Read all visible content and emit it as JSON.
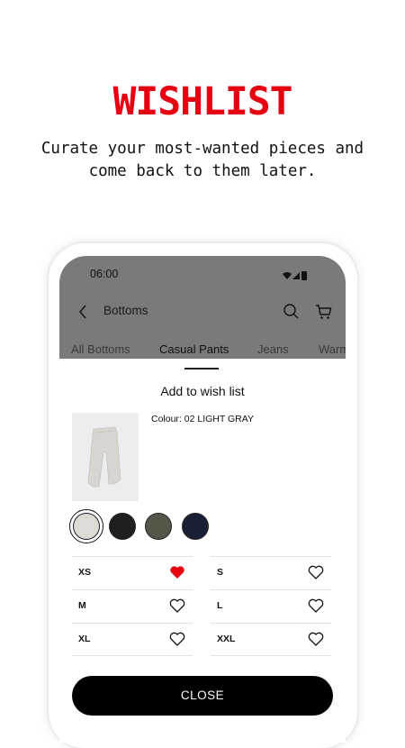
{
  "promo": {
    "title": "WISHLIST",
    "subtitle_line1": "Curate your most-wanted pieces and",
    "subtitle_line2": "come back to them later.",
    "title_color": "#e60012"
  },
  "phone": {
    "status_time": "06:00",
    "status_icons": [
      "wifi-icon",
      "signal-icon",
      "battery-icon"
    ],
    "appbar": {
      "title": "Bottoms",
      "icons": [
        "back-chevron-icon",
        "search-icon",
        "cart-icon"
      ]
    },
    "tabs": [
      {
        "label": "All Bottoms",
        "active": false
      },
      {
        "label": "Casual Pants",
        "active": true
      },
      {
        "label": "Jeans",
        "active": false
      },
      {
        "label": "Warm",
        "active": false
      }
    ],
    "sheet": {
      "title": "Add to wish list",
      "colour_text": "Colour: 02 LIGHT GRAY",
      "swatches": [
        {
          "name": "light-gray",
          "color": "#dedbd7",
          "selected": true
        },
        {
          "name": "black",
          "color": "#1f1f1f",
          "selected": false
        },
        {
          "name": "olive",
          "color": "#545646",
          "selected": false
        },
        {
          "name": "navy",
          "color": "#192035",
          "selected": false
        }
      ],
      "sizes": [
        {
          "label": "XS",
          "wished": true
        },
        {
          "label": "S",
          "wished": false
        },
        {
          "label": "M",
          "wished": false
        },
        {
          "label": "L",
          "wished": false
        },
        {
          "label": "XL",
          "wished": false
        },
        {
          "label": "XXL",
          "wished": false
        }
      ],
      "close_label": "CLOSE",
      "heart_active_color": "#e60012"
    }
  }
}
